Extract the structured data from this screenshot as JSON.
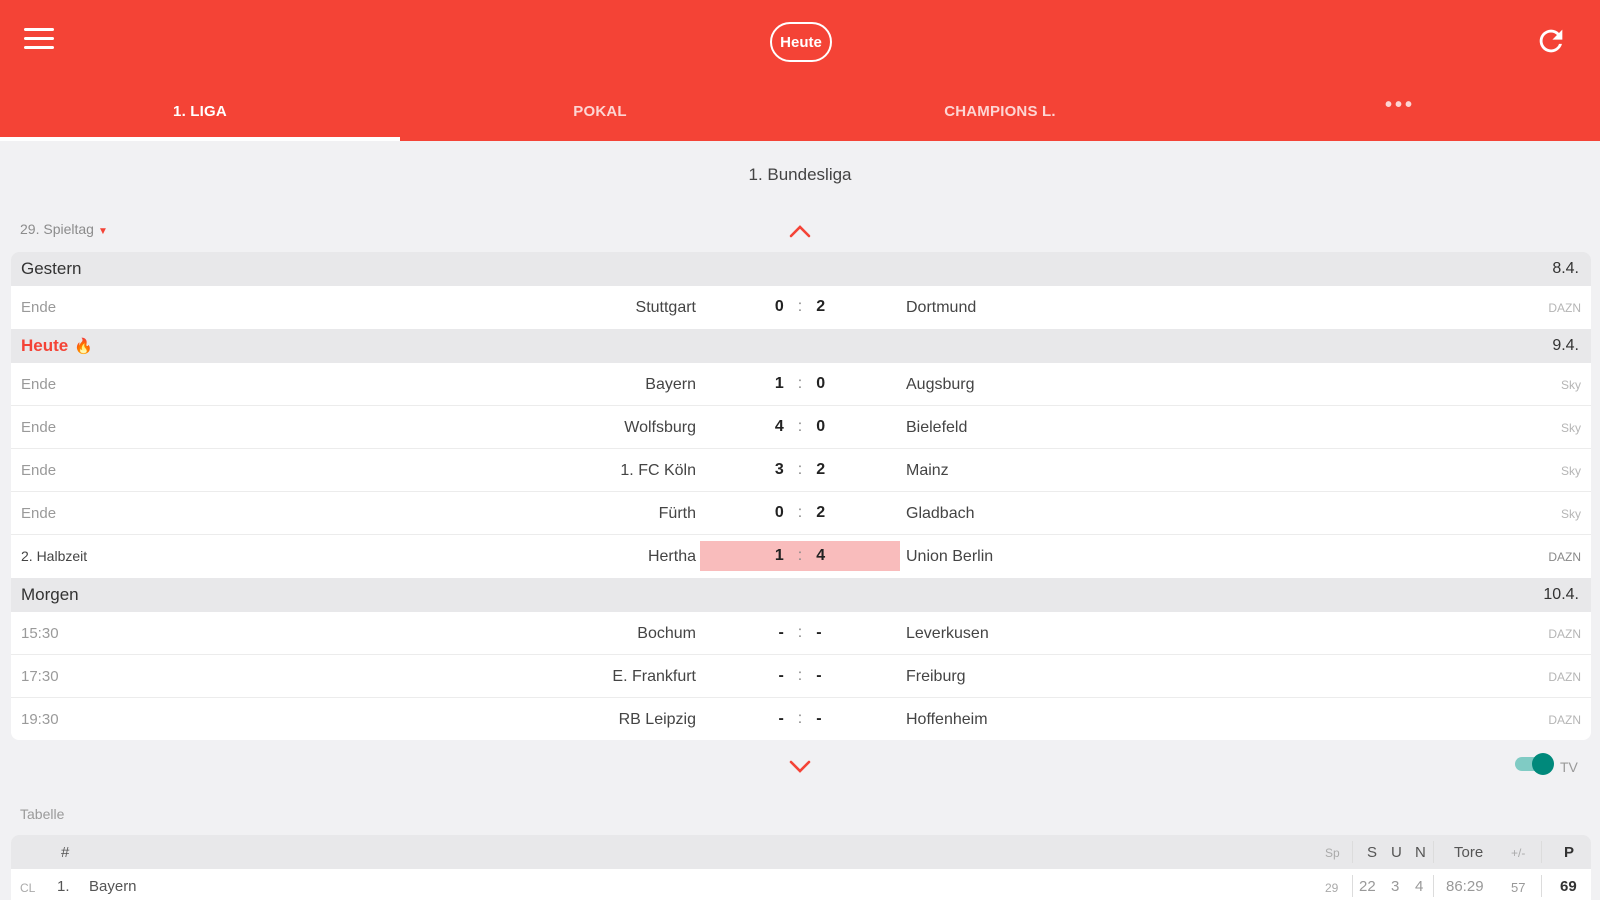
{
  "header": {
    "logo_text": "Heute",
    "brand_color": "#f44336",
    "menu_icon": "hamburger-menu-icon",
    "refresh_icon": "refresh-icon",
    "tabs": [
      {
        "label": "1. LIGA",
        "active": true
      },
      {
        "label": "POKAL",
        "active": false
      },
      {
        "label": "CHAMPIONS L.",
        "active": false
      },
      {
        "label": "•••",
        "active": false
      }
    ]
  },
  "league": {
    "title": "1. Bundesliga"
  },
  "matchday": {
    "label": "29. Spieltag"
  },
  "days": [
    {
      "label": "Gestern",
      "date": "8.4.",
      "today": false,
      "matches": [
        {
          "status": "Ende",
          "home": "Stuttgart",
          "home_goals": "0",
          "away_goals": "2",
          "away": "Dortmund",
          "tv": "DAZN"
        }
      ]
    },
    {
      "label": "Heute",
      "emoji": "🔥",
      "date": "9.4.",
      "today": true,
      "matches": [
        {
          "status": "Ende",
          "home": "Bayern",
          "home_goals": "1",
          "away_goals": "0",
          "away": "Augsburg",
          "tv": "Sky"
        },
        {
          "status": "Ende",
          "home": "Wolfsburg",
          "home_goals": "4",
          "away_goals": "0",
          "away": "Bielefeld",
          "tv": "Sky"
        },
        {
          "status": "Ende",
          "home": "1. FC Köln",
          "home_goals": "3",
          "away_goals": "2",
          "away": "Mainz",
          "tv": "Sky"
        },
        {
          "status": "Ende",
          "home": "Fürth",
          "home_goals": "0",
          "away_goals": "2",
          "away": "Gladbach",
          "tv": "Sky"
        },
        {
          "status": "2. Halbzeit",
          "home": "Hertha",
          "home_goals": "1",
          "away_goals": "4",
          "away": "Union Berlin",
          "tv": "DAZN",
          "live": true
        }
      ]
    },
    {
      "label": "Morgen",
      "date": "10.4.",
      "today": false,
      "matches": [
        {
          "status": "15:30",
          "home": "Bochum",
          "home_goals": "-",
          "away_goals": "-",
          "away": "Leverkusen",
          "tv": "DAZN"
        },
        {
          "status": "17:30",
          "home": "E. Frankfurt",
          "home_goals": "-",
          "away_goals": "-",
          "away": "Freiburg",
          "tv": "DAZN"
        },
        {
          "status": "19:30",
          "home": "RB Leipzig",
          "home_goals": "-",
          "away_goals": "-",
          "away": "Hoffenheim",
          "tv": "DAZN"
        }
      ]
    }
  ],
  "score_separator": ":",
  "tv_toggle": {
    "label": "TV",
    "on": true,
    "color": "#00897b"
  },
  "table": {
    "label": "Tabelle",
    "headers": {
      "rank": "#",
      "games": "Sp",
      "won": "S",
      "draw": "U",
      "lost": "N",
      "goals": "Tore",
      "diff": "+/-",
      "points": "P"
    },
    "rows": [
      {
        "zone": "CL",
        "rank": "1.",
        "team": "Bayern",
        "games": "29",
        "won": "22",
        "draw": "3",
        "lost": "4",
        "goals": "86:29",
        "diff": "57",
        "points": "69"
      }
    ]
  }
}
